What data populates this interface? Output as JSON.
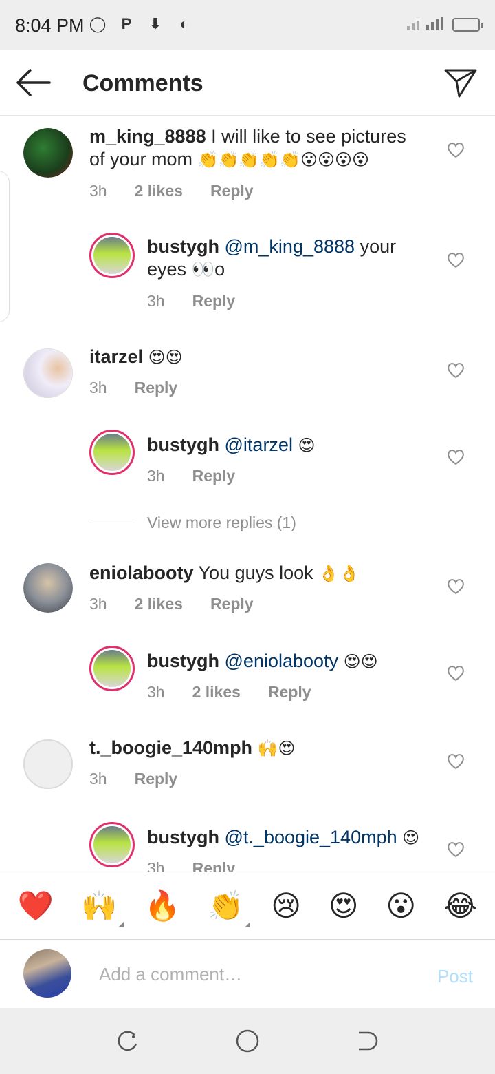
{
  "status_bar": {
    "time": "8:04 PM"
  },
  "header": {
    "title": "Comments"
  },
  "comments": [
    {
      "username": "m_king_8888",
      "text": "I will like to see pictures of your mom",
      "emojis": "👏👏👏👏👏😮😮😮😮",
      "time": "3h",
      "likes": "2 likes",
      "reply_label": "Reply",
      "reply": {
        "username": "bustygh",
        "mention": "@m_king_8888",
        "text": "your eyes 👀o",
        "time": "3h",
        "reply_label": "Reply"
      }
    },
    {
      "username": "itarzel",
      "text": "",
      "emojis": "😍😍",
      "time": "3h",
      "reply_label": "Reply",
      "reply": {
        "username": "bustygh",
        "mention": "@itarzel",
        "text": "😍",
        "time": "3h",
        "reply_label": "Reply"
      },
      "view_more": "View more replies (1)"
    },
    {
      "username": "eniolabooty",
      "text": "You guys look",
      "emojis": "👌👌",
      "time": "3h",
      "likes": "2 likes",
      "reply_label": "Reply",
      "reply": {
        "username": "bustygh",
        "mention": "@eniolabooty",
        "text": "😍😍",
        "time": "3h",
        "likes": "2 likes",
        "reply_label": "Reply"
      }
    },
    {
      "username": "t._boogie_140mph",
      "text": "",
      "emojis": "🙌😍",
      "time": "3h",
      "reply_label": "Reply",
      "reply": {
        "username": "bustygh",
        "mention": "@t._boogie_140mph",
        "text": "😍",
        "time": "3h",
        "reply_label": "Reply"
      }
    }
  ],
  "reactions": [
    "❤️",
    "🙌",
    "🔥",
    "👏",
    "😢",
    "😍",
    "😮",
    "😂"
  ],
  "composer": {
    "placeholder": "Add a comment…",
    "post_label": "Post"
  },
  "colors": {
    "mention": "#003569",
    "meta": "#8e8e8e",
    "post_disabled": "#b2dffc",
    "story_ring": "#e1306c"
  }
}
